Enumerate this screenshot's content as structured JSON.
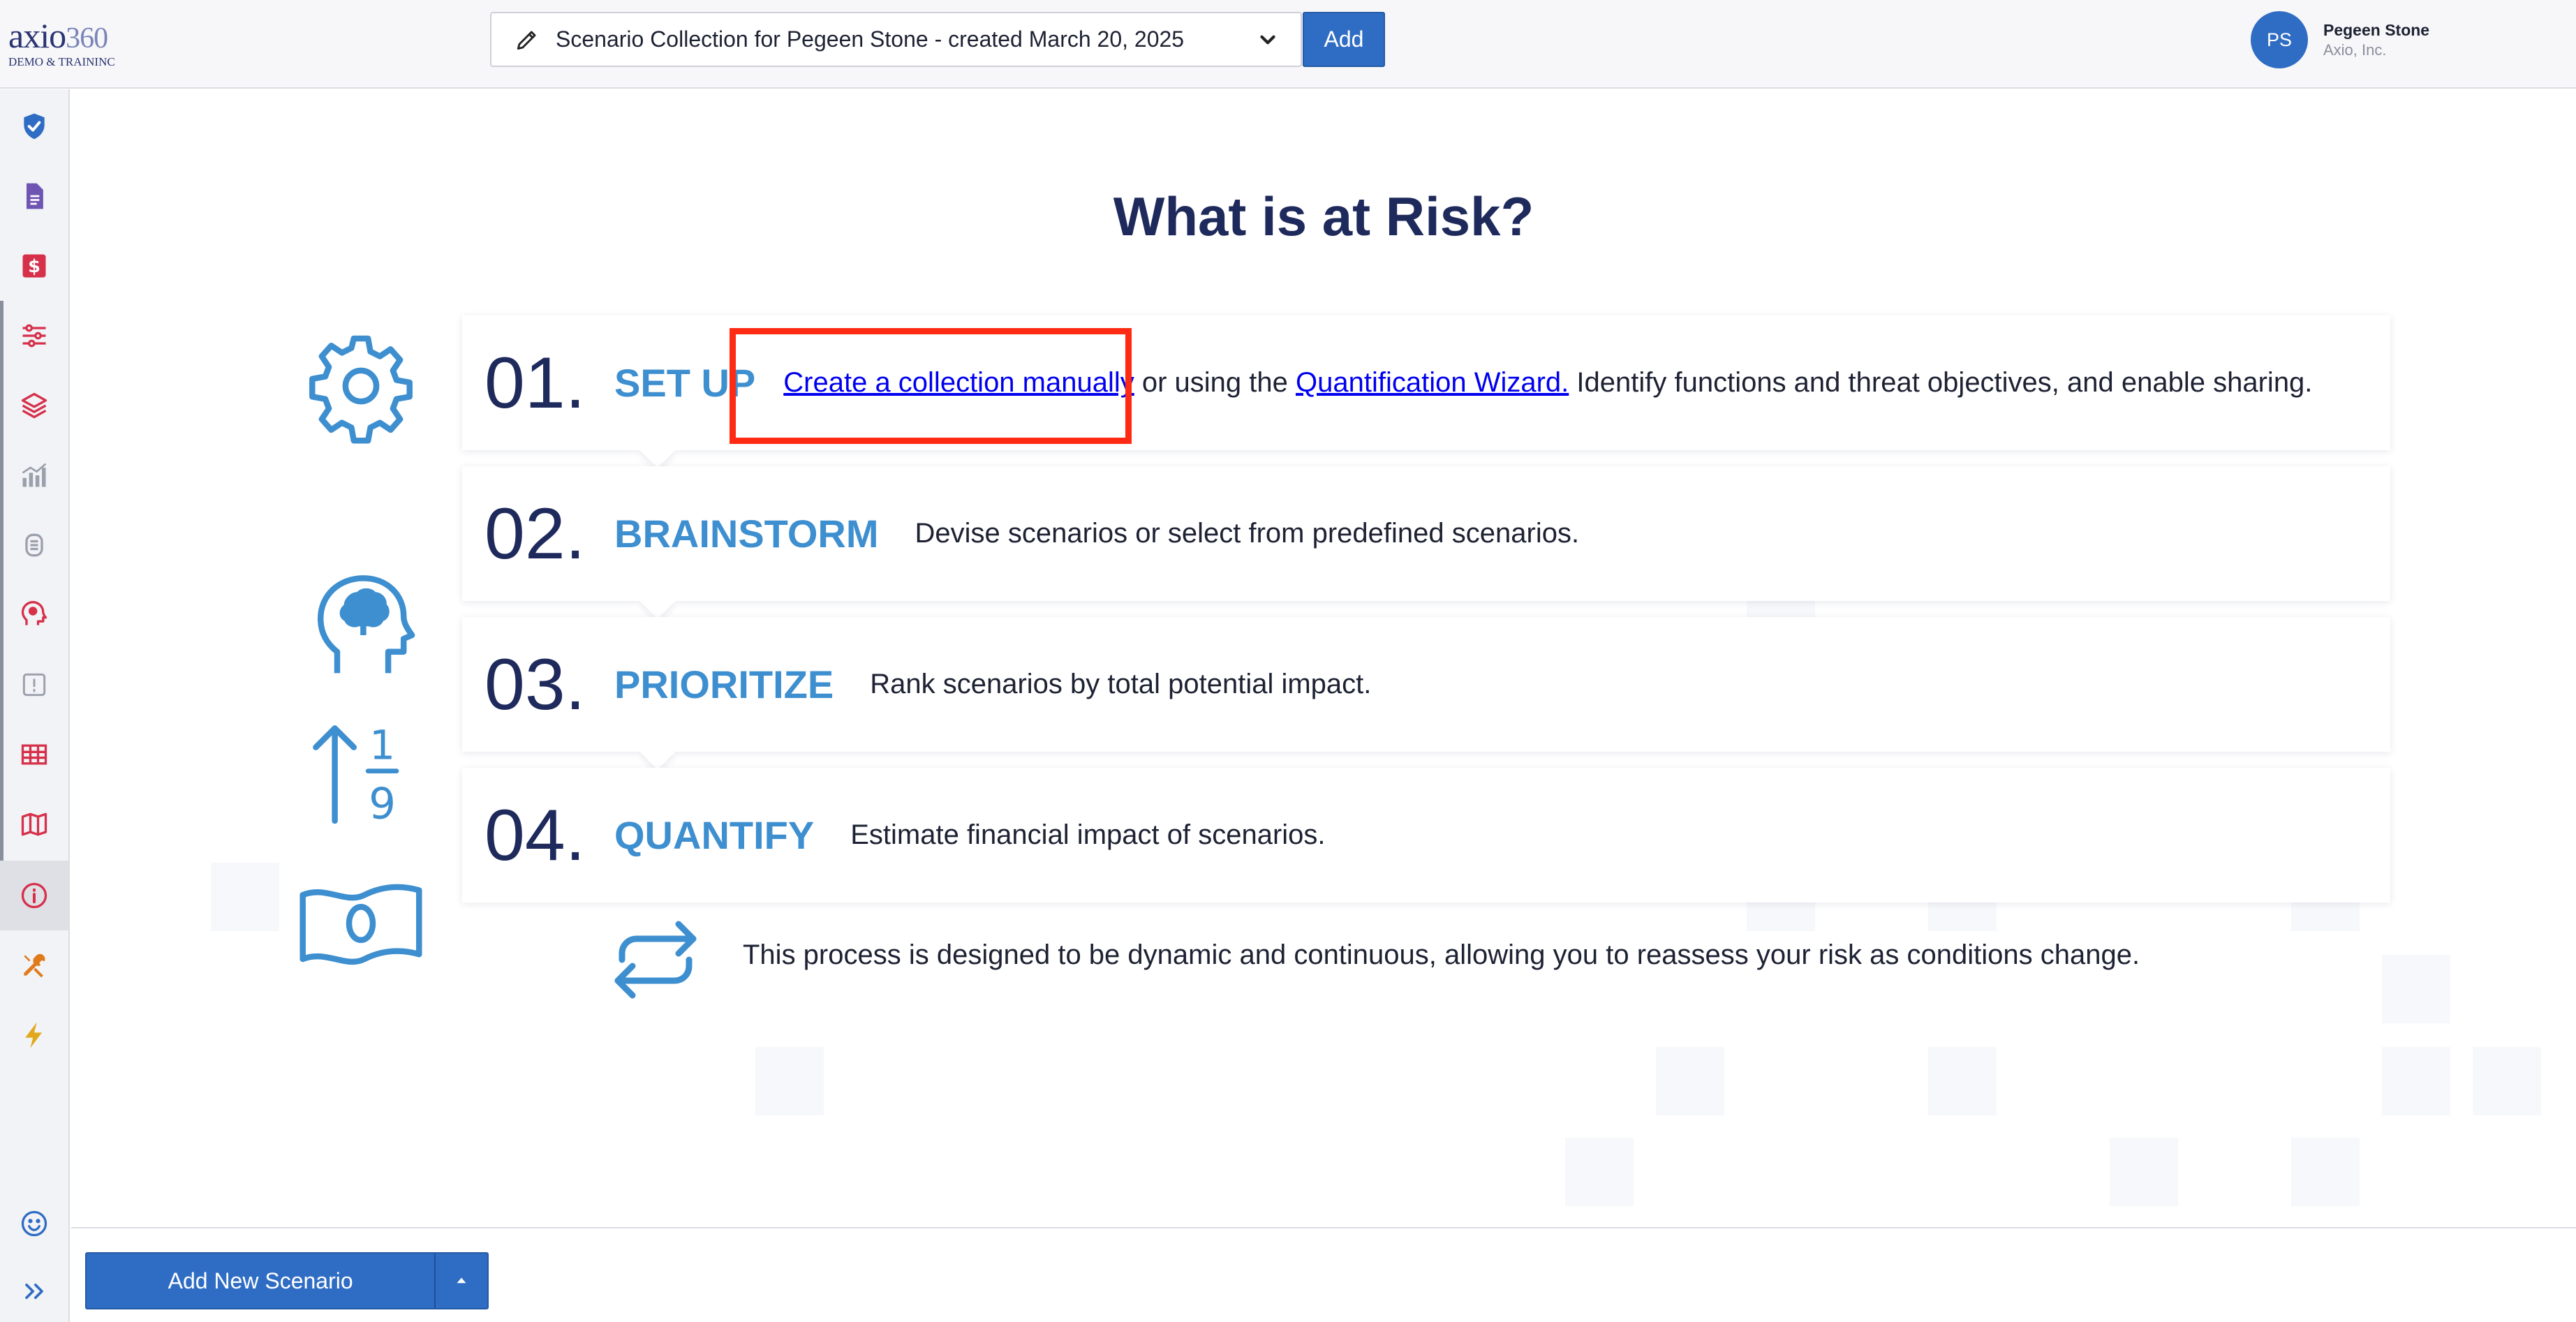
{
  "header": {
    "logo_main": "axio",
    "logo_number": "360",
    "logo_sub": "DEMO & TRAININC",
    "collection_select": {
      "value": "Scenario Collection for Pegeen Stone - created March 20, 2025"
    },
    "add_label": "Add",
    "user": {
      "initials": "PS",
      "name": "Pegeen Stone",
      "org": "Axio, Inc."
    }
  },
  "sidebar": {
    "items": [
      {
        "icon": "shield-check-icon",
        "color": "#2f6dc4"
      },
      {
        "icon": "document-icon",
        "color": "#6e54b3"
      },
      {
        "icon": "dollar-icon",
        "color": "#d6304a"
      },
      {
        "icon": "sliders-icon",
        "color": "#d6304a"
      },
      {
        "icon": "layers-icon",
        "color": "#d6304a"
      },
      {
        "icon": "chart-icon",
        "color": "#9aa0ac"
      },
      {
        "icon": "brain-gear-icon",
        "color": "#9aa0ac"
      },
      {
        "icon": "head-icon",
        "color": "#d6304a"
      },
      {
        "icon": "alert-box-icon",
        "color": "#9aa0ac"
      },
      {
        "icon": "table-icon",
        "color": "#d6304a"
      },
      {
        "icon": "map-icon",
        "color": "#d6304a"
      },
      {
        "icon": "info-icon",
        "color": "#d6304a"
      },
      {
        "icon": "tools-icon",
        "color": "#e07a1a"
      },
      {
        "icon": "lightning-icon",
        "color": "#e0a81a"
      }
    ],
    "bottom": [
      {
        "icon": "smiley-icon",
        "color": "#2f6dc4"
      },
      {
        "icon": "expand-icon",
        "color": "#2f6dc4"
      }
    ]
  },
  "main": {
    "title": "What is at Risk?",
    "steps": [
      {
        "num": "01.",
        "title": "SET UP",
        "link1": "Create a collection manually",
        "mid": " or using the ",
        "link2": "Quantification Wizard.",
        "rest": " Identify functions and threat objectives, and enable sharing.",
        "icon": "gear-icon"
      },
      {
        "num": "02.",
        "title": "BRAINSTORM",
        "desc": "Devise scenarios or select from predefined scenarios.",
        "icon": "head-brain-icon"
      },
      {
        "num": "03.",
        "title": "PRIORITIZE",
        "desc": "Rank scenarios by total potential impact.",
        "icon": "sort-ascending-icon"
      },
      {
        "num": "04.",
        "title": "QUANTIFY",
        "desc": "Estimate financial impact of scenarios.",
        "icon": "banknote-icon"
      }
    ],
    "cycle_text": "This process is designed to be dynamic and continuous, allowing you to reassess your risk as conditions change.",
    "accent_color": "#3e8fd0",
    "highlight_color": "#ff2a14"
  },
  "footer": {
    "add_new_scenario": "Add New Scenario"
  }
}
